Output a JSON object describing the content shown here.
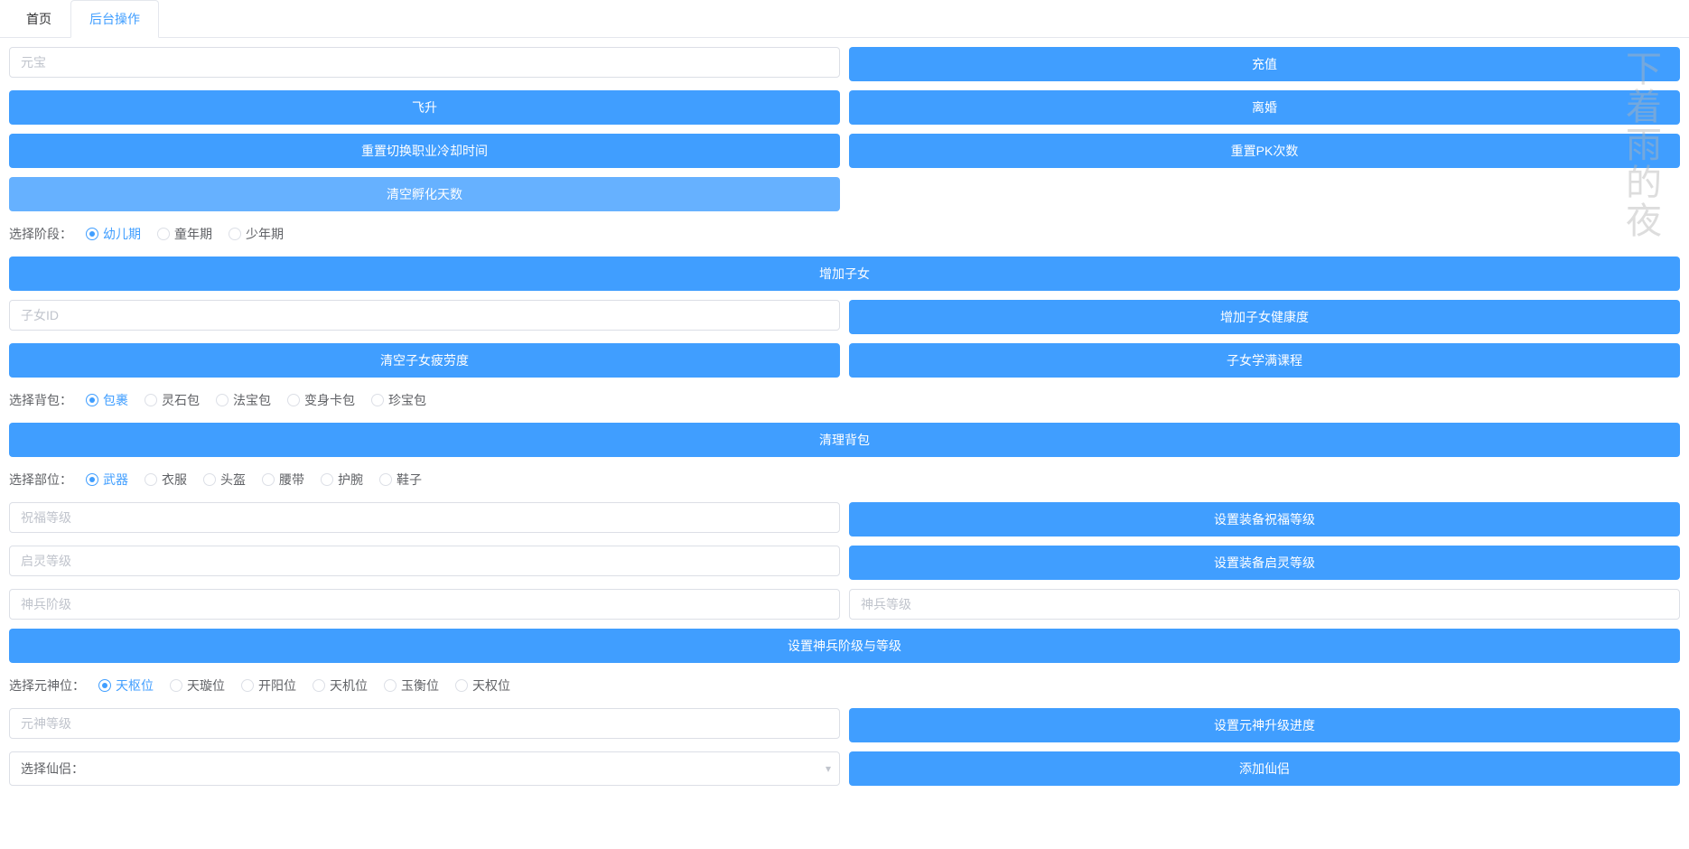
{
  "tabs": {
    "home": "首页",
    "admin": "后台操作"
  },
  "watermark": "下着雨的夜",
  "inputs": {
    "yuanbao": "元宝",
    "childId": "子女ID",
    "blessLevel": "祝福等级",
    "qilingLevel": "启灵等级",
    "shenbingStage": "神兵阶级",
    "shenbingLevel": "神兵等级",
    "yuanshenLevel": "元神等级",
    "selectXianlv": "选择仙侣："
  },
  "buttons": {
    "recharge": "充值",
    "ascend": "飞升",
    "divorce": "离婚",
    "resetJobCooldown": "重置切换职业冷却时间",
    "resetPkCount": "重置PK次数",
    "clearHatchDays": "清空孵化天数",
    "addChild": "增加子女",
    "addChildHealth": "增加子女健康度",
    "clearChildFatigue": "清空子女疲劳度",
    "childFullCourse": "子女学满课程",
    "clearBag": "清理背包",
    "setEquipBless": "设置装备祝福等级",
    "setEquipQiling": "设置装备启灵等级",
    "setShenbingStage": "设置神兵阶级与等级",
    "setYuanshenProgress": "设置元神升级进度",
    "addXianlv": "添加仙侣"
  },
  "radios": {
    "stage": {
      "label": "选择阶段：",
      "options": [
        "幼儿期",
        "童年期",
        "少年期"
      ]
    },
    "bag": {
      "label": "选择背包：",
      "options": [
        "包裹",
        "灵石包",
        "法宝包",
        "变身卡包",
        "珍宝包"
      ]
    },
    "part": {
      "label": "选择部位：",
      "options": [
        "武器",
        "衣服",
        "头盔",
        "腰带",
        "护腕",
        "鞋子"
      ]
    },
    "yuanshen": {
      "label": "选择元神位：",
      "options": [
        "天枢位",
        "天璇位",
        "开阳位",
        "天机位",
        "玉衡位",
        "天权位"
      ]
    }
  }
}
